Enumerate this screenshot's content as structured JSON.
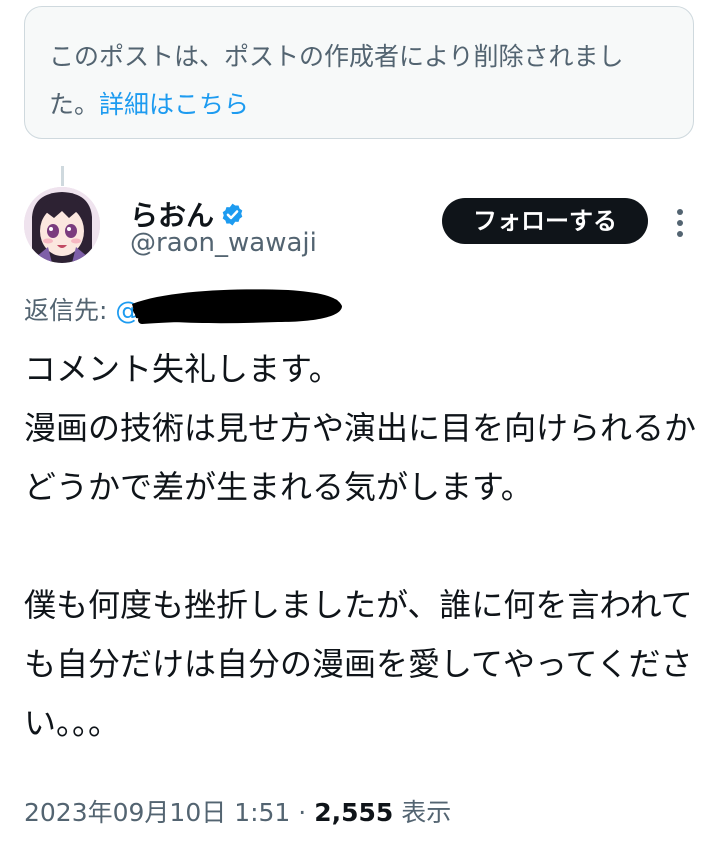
{
  "notice": {
    "text": "このポストは、ポストの作成者により削除されました。",
    "link": "詳細はこちら"
  },
  "author": {
    "name": "らおん",
    "handle": "@raon_wawaji",
    "verified_color": "#1d9bf0"
  },
  "follow_button": {
    "label": "フォローする"
  },
  "reply": {
    "label": "返信先:",
    "target": "@"
  },
  "post": {
    "lines": [
      "コメント失礼します。",
      "漫画の技術は見せ方や演出に目を向けられるかどうかで差が生まれる気がします。",
      "",
      "僕も何度も挫折しましたが、誰に何を言われても自分だけは自分の漫画を愛してやってください。。。"
    ]
  },
  "meta": {
    "datetime": "2023年09月10日 1:51",
    "separator": "·",
    "views_count": "2,555",
    "views_label": "表示"
  },
  "colors": {
    "accent": "#1d9bf0",
    "muted": "#536471",
    "text": "#0f1419",
    "border": "#cfd9de"
  }
}
